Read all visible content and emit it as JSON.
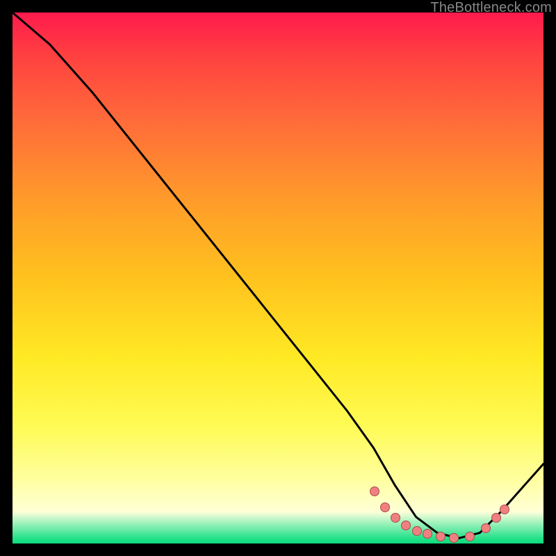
{
  "attribution": "TheBottleneck.com",
  "chart_data": {
    "type": "line",
    "title": "",
    "xlabel": "",
    "ylabel": "",
    "xlim": [
      0,
      100
    ],
    "ylim": [
      0,
      100
    ],
    "grid": false,
    "legend": false,
    "background": "rainbow_gradient_red_to_green",
    "series": [
      {
        "name": "curve",
        "x": [
          0,
          7,
          15,
          25,
          35,
          45,
          55,
          63,
          68,
          72,
          76,
          80,
          84,
          88,
          92,
          100
        ],
        "y": [
          100,
          94,
          85,
          72.5,
          60,
          47.5,
          35,
          25,
          18,
          11,
          5,
          2,
          1,
          2,
          6,
          15
        ]
      }
    ],
    "markers": {
      "name": "highlighted-points",
      "color": "#f08080",
      "points": [
        {
          "x": 68,
          "y": 10
        },
        {
          "x": 70,
          "y": 7
        },
        {
          "x": 72,
          "y": 5
        },
        {
          "x": 74,
          "y": 3.5
        },
        {
          "x": 76,
          "y": 2.5
        },
        {
          "x": 78,
          "y": 2
        },
        {
          "x": 80.5,
          "y": 1.5
        },
        {
          "x": 83,
          "y": 1.2
        },
        {
          "x": 86,
          "y": 1.5
        },
        {
          "x": 89,
          "y": 3
        },
        {
          "x": 91,
          "y": 5
        },
        {
          "x": 92.5,
          "y": 6.5
        }
      ]
    }
  }
}
